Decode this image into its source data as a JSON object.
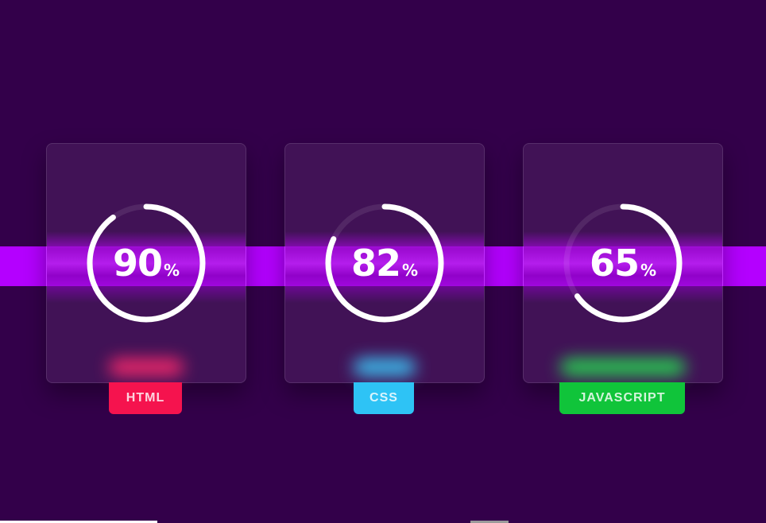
{
  "cards": [
    {
      "value": "90",
      "unit": "%",
      "label": "HTML",
      "percent": 0.9,
      "color": "#f5134e",
      "glow": "#ff2a6d"
    },
    {
      "value": "82",
      "unit": "%",
      "label": "CSS",
      "percent": 0.82,
      "color": "#2ec3f5",
      "glow": "#3bd0ff"
    },
    {
      "value": "65",
      "unit": "%",
      "label": "JAVASCRIPT",
      "percent": 0.65,
      "color": "#10c43a",
      "glow": "#25e050"
    }
  ],
  "colors": {
    "background": "#33004a",
    "band": "#b400ff",
    "ring": "#ffffff"
  }
}
